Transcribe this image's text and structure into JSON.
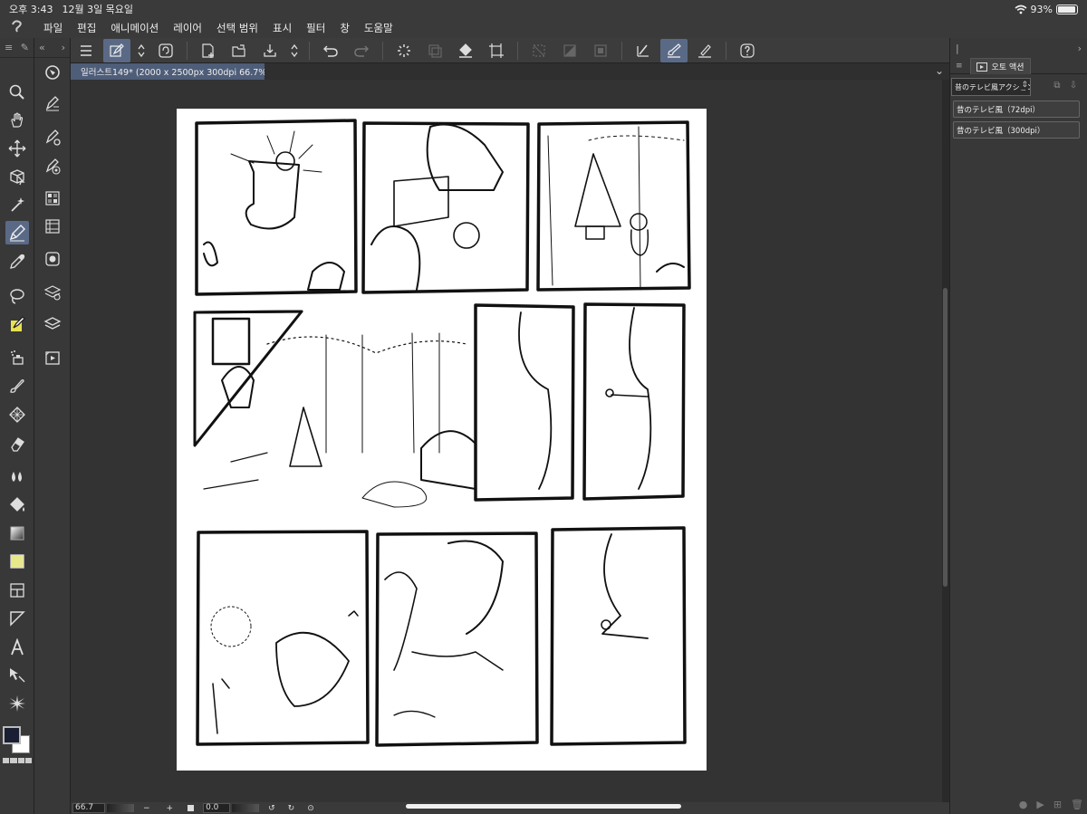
{
  "status_bar": {
    "time": "오후 3:43",
    "date": "12월 3일 목요일",
    "battery": "93%",
    "battery_level": 0.93
  },
  "menu": {
    "items": [
      "파일",
      "편집",
      "애니메이션",
      "레이어",
      "선택 범위",
      "표시",
      "필터",
      "창",
      "도움말"
    ]
  },
  "document": {
    "tab_title": "일러스트149* (2000 x 2500px 300dpi 66.7%)"
  },
  "bottom_bar": {
    "zoom": "66.7",
    "minus": "−",
    "plus": "+",
    "rotation": "0.0"
  },
  "auto_action": {
    "tab_label": "오토 액션",
    "set_name": "昔のテレビ風アクション",
    "items": [
      "昔のテレビ風（72dpi）",
      "昔のテレビ風（300dpi）"
    ]
  },
  "colors": {
    "accent": "#5a6a86",
    "foreground": "#1a1f33",
    "background": "#ffffff",
    "highlight": "#e8e88a"
  }
}
